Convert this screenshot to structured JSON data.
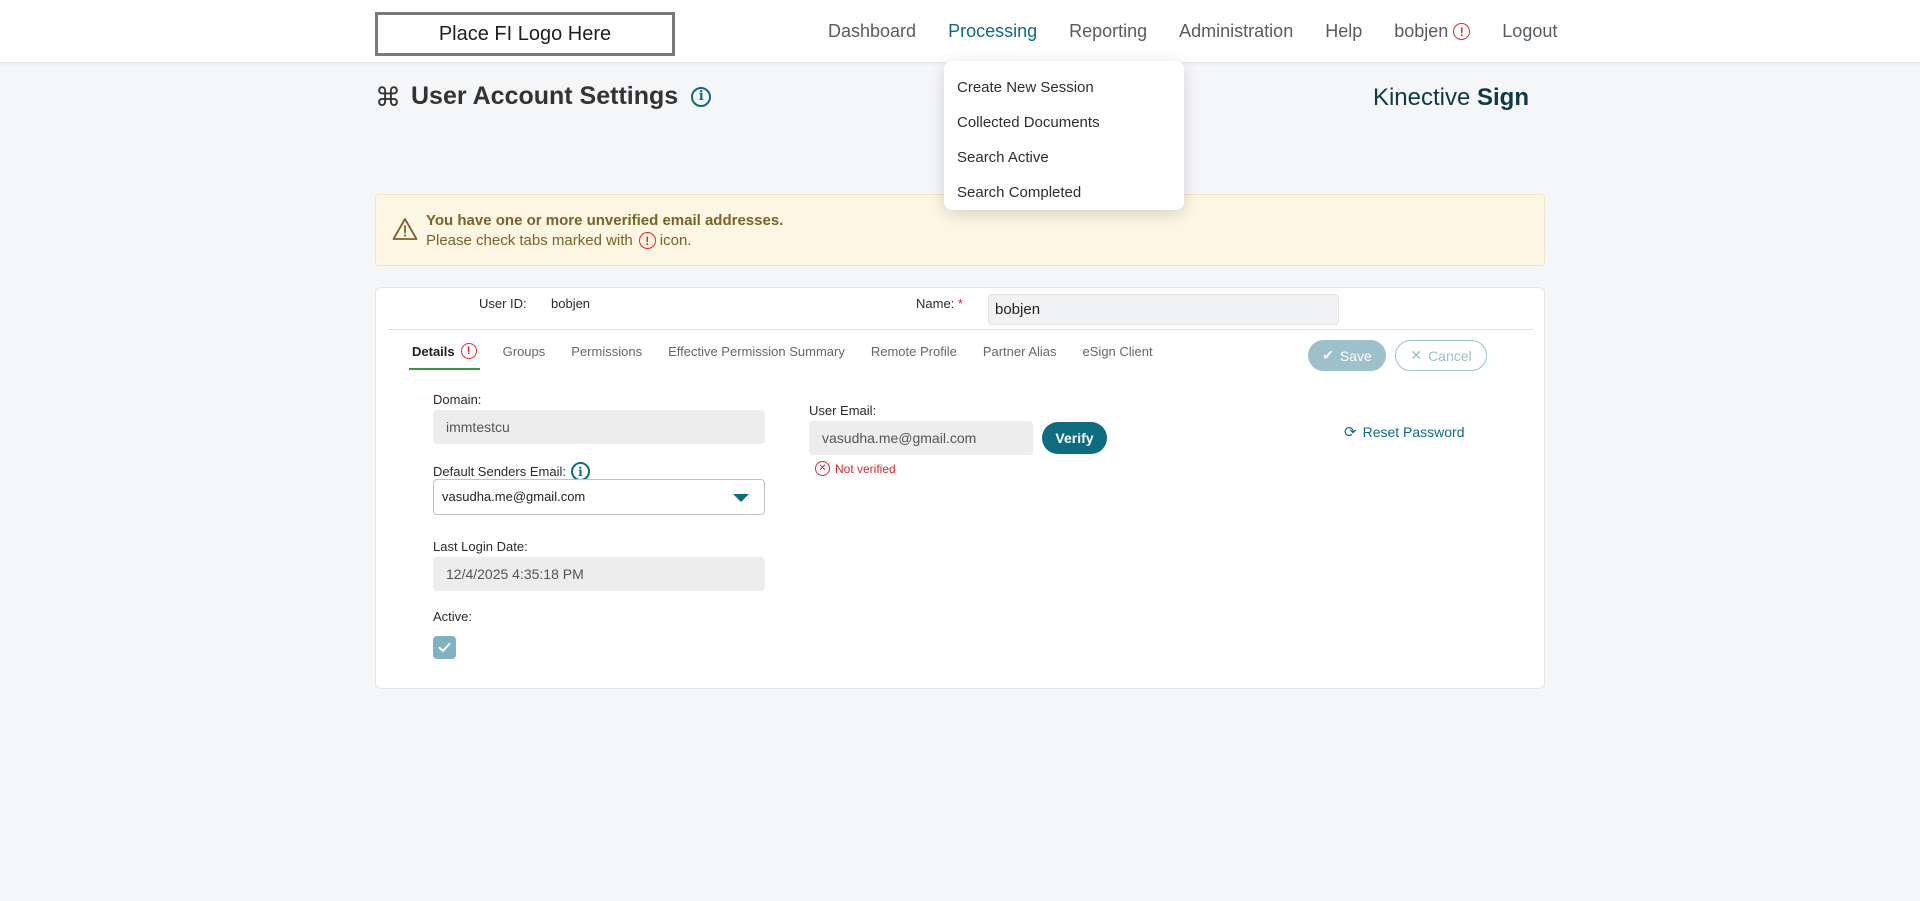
{
  "header": {
    "logo_text": "Place FI Logo Here",
    "nav": [
      {
        "label": "Dashboard"
      },
      {
        "label": "Processing"
      },
      {
        "label": "Reporting"
      },
      {
        "label": "Administration"
      },
      {
        "label": "Help"
      },
      {
        "label": "bobjen"
      },
      {
        "label": "Logout"
      }
    ],
    "alert_glyph": "!"
  },
  "processing_menu": {
    "items": [
      "Create New Session",
      "Collected Documents",
      "Search Active",
      "Search Completed"
    ]
  },
  "page": {
    "title": "User Account Settings",
    "info_glyph": "i",
    "brand_light": "Kinective",
    "brand_bold": "Sign"
  },
  "banner": {
    "title": "You have one or more unverified email addresses.",
    "text_before": "Please check tabs marked with",
    "text_after": "icon."
  },
  "form": {
    "user_id_label": "User ID:",
    "user_id_value": "bobjen",
    "name_label": "Name:",
    "required_mark": "*",
    "name_value": "bobjen",
    "tabs": [
      "Details",
      "Groups",
      "Permissions",
      "Effective Permission Summary",
      "Remote Profile",
      "Partner Alias",
      "eSign Client"
    ],
    "save_label": "Save",
    "cancel_label": "Cancel",
    "domain_label": "Domain:",
    "domain_value": "immtestcu",
    "default_senders_label": "Default Senders Email:",
    "default_senders_value": "vasudha.me@gmail.com",
    "last_login_label": "Last Login Date:",
    "last_login_value": "12/4/2025 4:35:18 PM",
    "active_label": "Active:",
    "active_checked": true,
    "user_email_label": "User Email:",
    "user_email_value": "vasudha.me@gmail.com",
    "verify_label": "Verify",
    "not_verified_text": "Not verified",
    "reset_password_label": "Reset Password"
  },
  "colors": {
    "accent": "#0d6c80",
    "error": "#e22a2a",
    "warning_bg": "#fcf6e3",
    "active_tab_underline": "#2e9d3d"
  },
  "icons": [
    "command-icon",
    "info-icon",
    "warning-triangle-icon",
    "alert-circle-icon",
    "check-icon",
    "close-icon",
    "chevron-down-icon",
    "x-circle-icon",
    "reset-icon"
  ]
}
